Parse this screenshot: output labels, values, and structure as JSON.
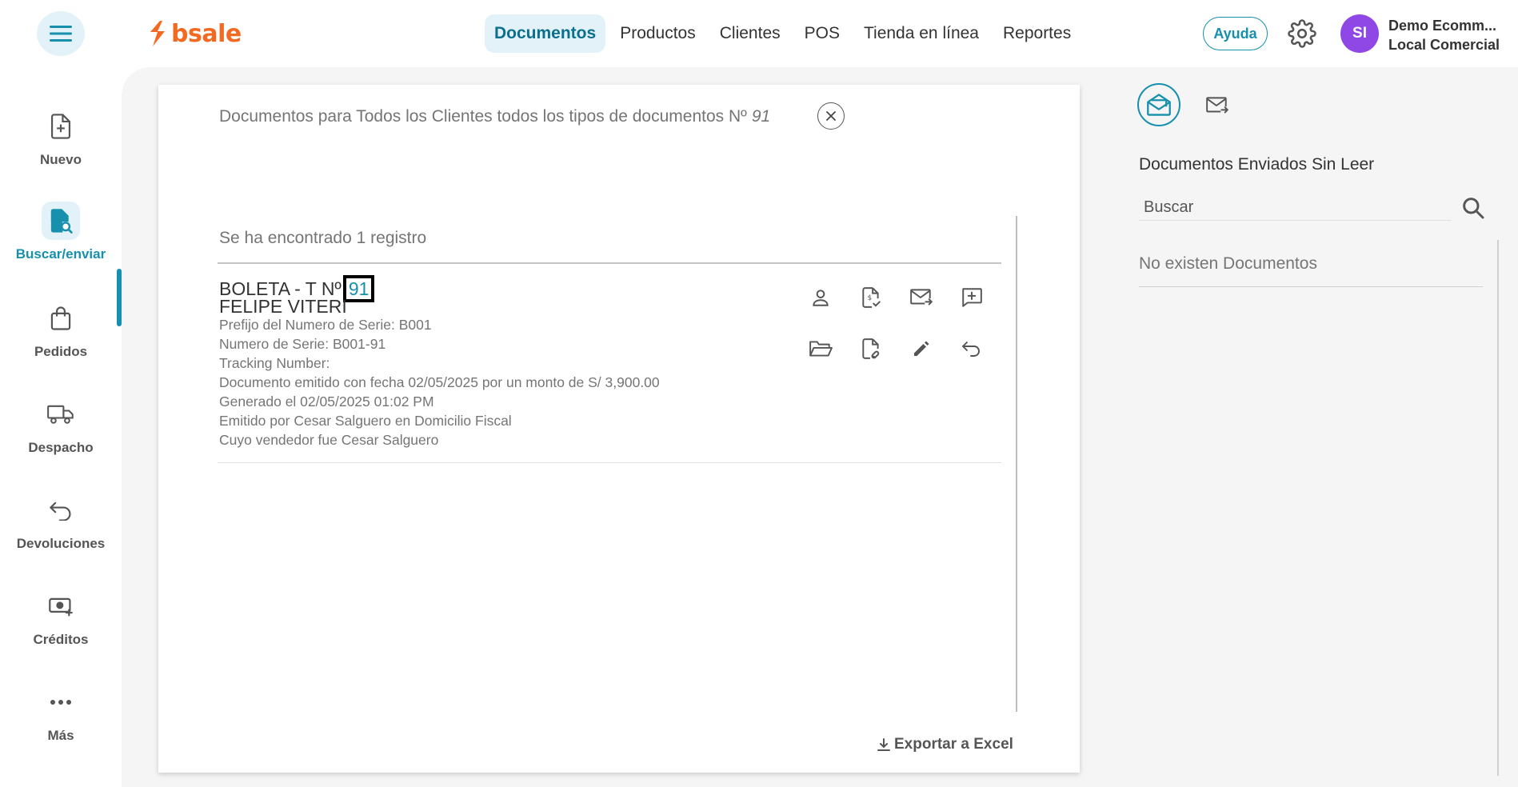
{
  "header": {
    "logo_text": "bsale",
    "nav": [
      {
        "label": "Documentos",
        "active": true
      },
      {
        "label": "Productos"
      },
      {
        "label": "Clientes"
      },
      {
        "label": "POS"
      },
      {
        "label": "Tienda en línea"
      },
      {
        "label": "Reportes"
      }
    ],
    "help_label": "Ayuda",
    "avatar_initials": "SI",
    "user_name": "Demo Ecomm...",
    "user_store": "Local Comercial"
  },
  "sidebar": {
    "items": [
      {
        "label": "Nuevo",
        "icon": "file-plus-icon"
      },
      {
        "label": "Buscar/enviar",
        "icon": "file-search-icon",
        "active": true
      },
      {
        "label": "Pedidos",
        "icon": "shopping-bag-icon"
      },
      {
        "label": "Despacho",
        "icon": "truck-icon"
      },
      {
        "label": "Devoluciones",
        "icon": "undo-icon"
      },
      {
        "label": "Créditos",
        "icon": "cash-plus-icon"
      },
      {
        "label": "Más",
        "icon": "more-dots-icon"
      }
    ]
  },
  "main": {
    "title_prefix": "Documentos para Todos los Clientes todos los tipos de documentos Nº",
    "title_number": "91",
    "result_count": "Se ha encontrado 1 registro",
    "document": {
      "type_label": "BOLETA - T Nº",
      "number": "91",
      "client": "FELIPE VITERI",
      "lines": [
        "Prefijo del Numero de Serie: B001",
        "Numero de Serie: B001-91",
        "Tracking Number:",
        "Documento emitido con fecha 02/05/2025 por un monto de S/ 3,900.00",
        "Generado el 02/05/2025 01:02 PM",
        "Emitido por Cesar Salguero en Domicilio Fiscal",
        "Cuyo vendedor fue Cesar Salguero"
      ]
    },
    "export_label": "Exportar a Excel"
  },
  "right_panel": {
    "title": "Documentos Enviados Sin Leer",
    "search_placeholder": "Buscar",
    "empty_text": "No existen Documentos"
  },
  "colors": {
    "accent": "#1690ad",
    "brand": "#f26a21",
    "avatar": "#8f47e6"
  }
}
